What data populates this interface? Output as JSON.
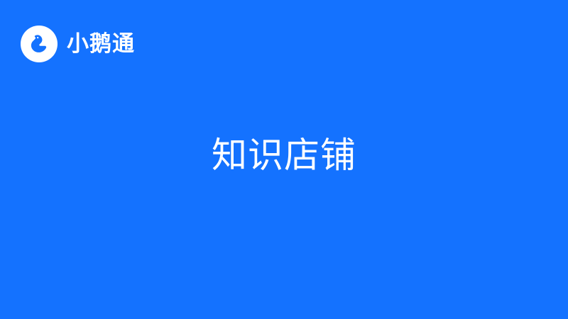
{
  "brand": {
    "name": "小鹅通",
    "logo_icon": "goose-logo-icon"
  },
  "main": {
    "title": "知识店铺"
  },
  "colors": {
    "background": "#1472ff",
    "foreground": "#ffffff"
  }
}
